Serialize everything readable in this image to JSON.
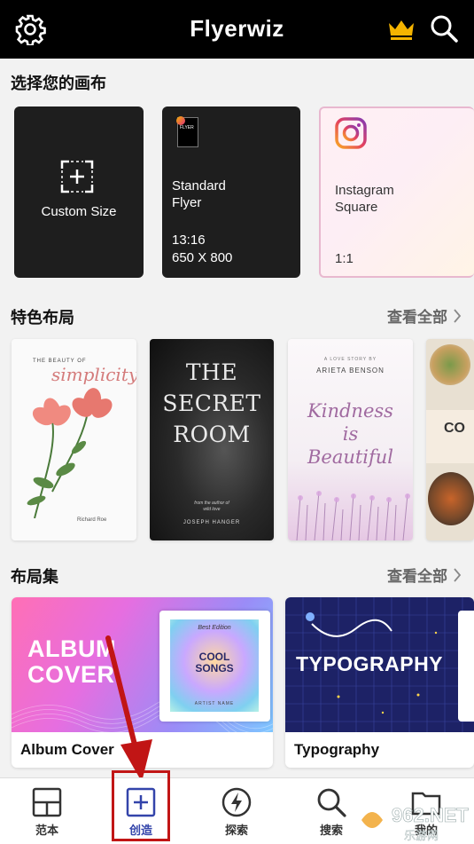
{
  "app": {
    "title": "Flyerwiz"
  },
  "header": {
    "settings_icon": "gear-icon",
    "premium_icon": "crown-icon",
    "search_icon": "search-icon",
    "crown_color": "#f5b400"
  },
  "canvas_section": {
    "title": "选择您的画布",
    "items": [
      {
        "name": "Custom Size"
      },
      {
        "name_line1": "Standard",
        "name_line2": "Flyer",
        "ratio": "13:16",
        "size": "650 X 800",
        "thumb_text": "FLYER"
      },
      {
        "name_line1": "Instagram",
        "name_line2": "Square",
        "ratio": "1:1"
      }
    ]
  },
  "featured_section": {
    "title": "特色布局",
    "see_all": "查看全部",
    "items": [
      {
        "kicker": "THE BEAUTY OF",
        "title": "simplicity",
        "author": "Richard Roe"
      },
      {
        "title_lines": [
          "THE",
          "SECRET",
          "ROOM"
        ],
        "byline": "from the author of",
        "byline2": "wild love",
        "author": "JOSEPH HANGER"
      },
      {
        "kicker": "A LOVE STORY BY",
        "author": "ARIETA BENSON",
        "title_lines": [
          "Kindness",
          "is",
          "Beautiful"
        ]
      },
      {
        "title": "CO"
      }
    ]
  },
  "collections_section": {
    "title": "布局集",
    "see_all": "查看全部",
    "items": [
      {
        "headline_line1": "ALBUM",
        "headline_line2": "COVER",
        "caption": "Album Cover",
        "album": {
          "edition": "Best Edition",
          "title_line1": "COOL",
          "title_line2": "SONGS",
          "artist": "ARTIST NAME"
        }
      },
      {
        "headline": "TYPOGRAPHY",
        "caption": "Typography"
      }
    ]
  },
  "bottom_nav": {
    "active": "create",
    "accent_color": "#3344aa",
    "items": [
      {
        "id": "templates",
        "label": "范本",
        "icon": "layout-grid-icon"
      },
      {
        "id": "create",
        "label": "创造",
        "icon": "plus-square-icon"
      },
      {
        "id": "explore",
        "label": "探索",
        "icon": "lightning-icon"
      },
      {
        "id": "search",
        "label": "搜索",
        "icon": "search-icon"
      },
      {
        "id": "folder",
        "label": "我的",
        "icon": "folder-icon"
      }
    ]
  },
  "watermark": {
    "text": "962.NET",
    "subtext": "乐游网"
  }
}
